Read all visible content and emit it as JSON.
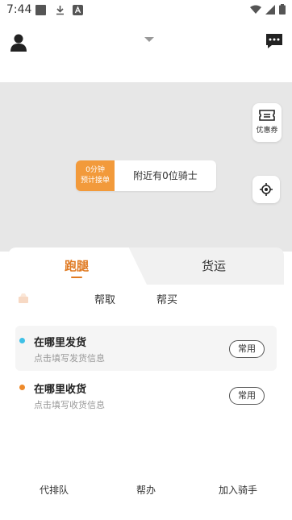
{
  "status_bar": {
    "time": "7:44",
    "left_icons": [
      "gallery-icon",
      "download-icon",
      "app-a-icon"
    ],
    "right_icons": [
      "wifi-icon",
      "signal-icon",
      "battery-icon"
    ]
  },
  "header": {
    "avatar_icon": "person-icon",
    "dropdown_icon": "triangle-down-icon",
    "chat_icon": "chat-bubble-icon"
  },
  "map": {
    "background": "#e7e7e7",
    "coupon_label": "优惠券",
    "locate_icon": "locate-icon",
    "rider_eta_line1": "0分钟",
    "rider_eta_line2": "预计接单",
    "rider_text": "附近有0位骑士",
    "accent": "#f29a3b"
  },
  "tabs": [
    {
      "label": "跑腿",
      "active": true
    },
    {
      "label": "货运",
      "active": false
    }
  ],
  "subtabs": [
    {
      "label": "帮取"
    },
    {
      "label": "帮买"
    }
  ],
  "addresses": [
    {
      "title": "在哪里发货",
      "hint": "点击填写发货信息",
      "dot_color": "#3ec0e6",
      "button": "常用"
    },
    {
      "title": "在哪里收货",
      "hint": "点击填写收货信息",
      "dot_color": "#ee8a2a",
      "button": "常用"
    }
  ],
  "bottom_links": [
    "代排队",
    "帮办",
    "加入骑手"
  ]
}
